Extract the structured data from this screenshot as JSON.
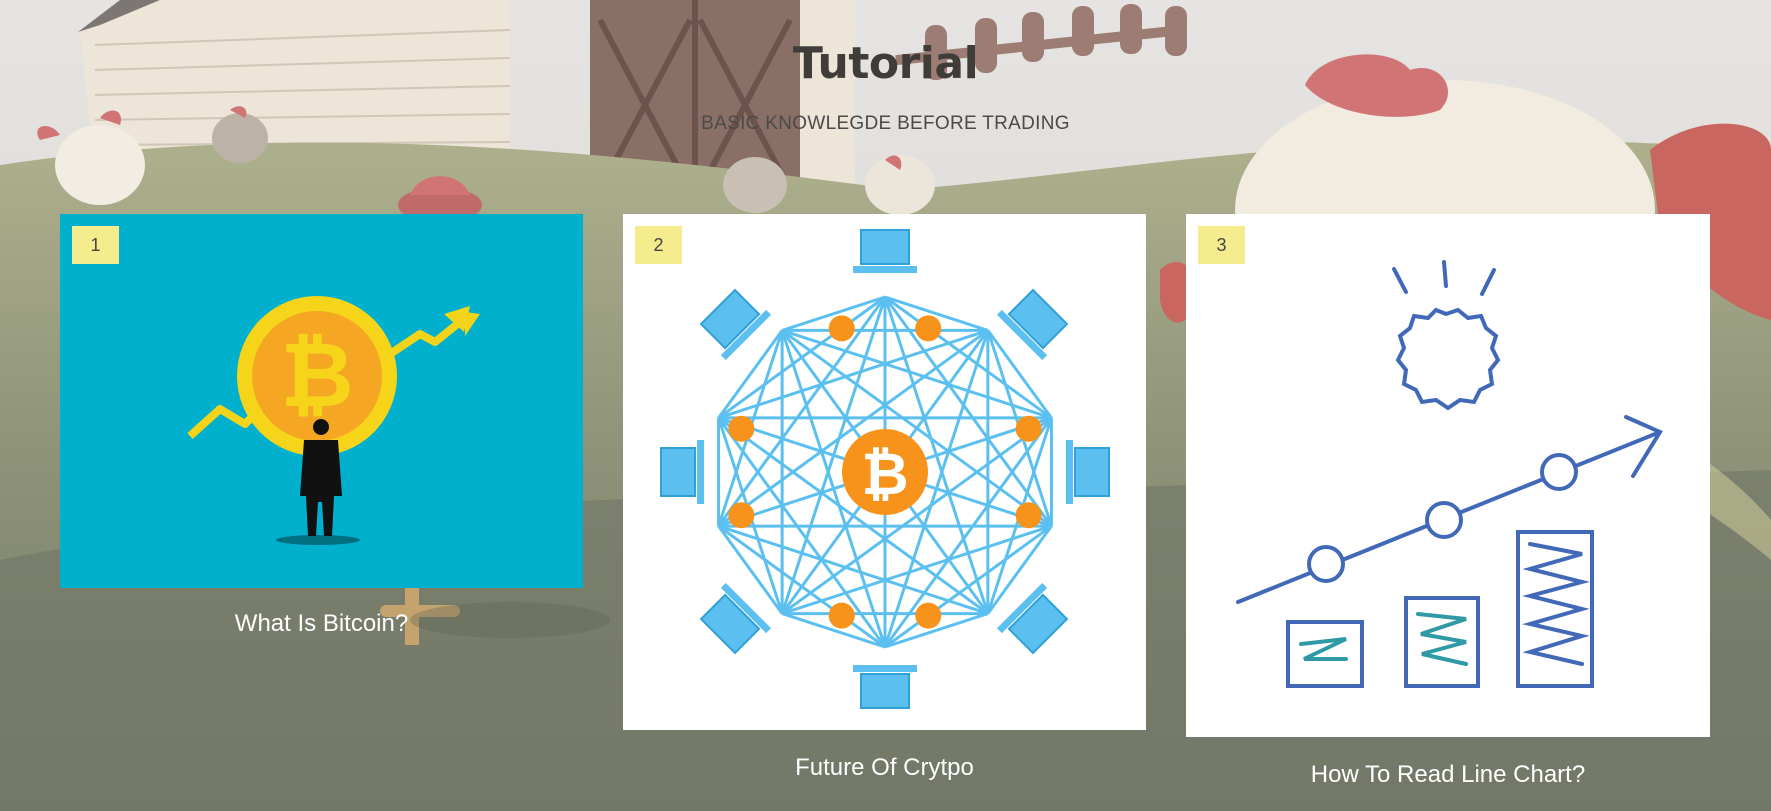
{
  "header": {
    "title": "Tutorial",
    "subtitle": "BASIC KNOWLEGDE BEFORE TRADING"
  },
  "cards": [
    {
      "number": "1",
      "caption": "What Is Bitcoin?",
      "image": "bitcoin-investor-illustration"
    },
    {
      "number": "2",
      "caption": "Future Of Crytpo",
      "image": "blockchain-network-illustration"
    },
    {
      "number": "3",
      "caption": "How To Read Line Chart?",
      "image": "line-chart-growth-illustration"
    }
  ],
  "colors": {
    "badge": "#f5ec8e",
    "card1_bg": "#00b0cc",
    "bitcoin_orange": "#f7931a",
    "network_blue": "#5bc0f0",
    "sketch_blue": "#4169b8",
    "caption_text": "#ffffff"
  }
}
